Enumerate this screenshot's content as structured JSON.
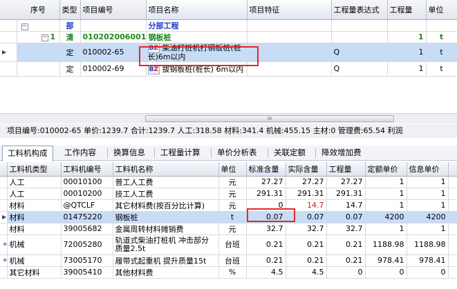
{
  "top_grid": {
    "columns": [
      "序号",
      "类型",
      "项目编号",
      "项目名称",
      "项目特征",
      "工程量表达式",
      "工程量",
      "单位"
    ],
    "rows": {
      "part": {
        "type": "部",
        "name": "分部工程"
      },
      "list": {
        "seq": "1",
        "type": "清",
        "code": "010202006001",
        "name": "钢板桩",
        "qty": "1",
        "unit": "t"
      },
      "item1": {
        "type": "定",
        "code": "010002-65",
        "badge": "BZ",
        "name": "柴油打桩机打钢板桩(桩长)6m以内",
        "expr": "Q",
        "qty": "1",
        "unit": "t"
      },
      "item2": {
        "type": "定",
        "code": "010002-69",
        "badge": "BZ",
        "name": "拔钢板桩(桩长) 6m以内",
        "expr": "Q",
        "qty": "1",
        "unit": "t"
      }
    }
  },
  "scrollbar": {
    "grip": "III"
  },
  "info_bar": "项目编号:010002-65  单价:1239.7  合计:1239.7  人工:318.58  材料:341.4  机械:455.15  主材:0  管理费:65.54  利润",
  "tabs": [
    "工料机构成",
    "工作内容",
    "换算信息",
    "工程量计算",
    "单价分析表",
    "关联定额",
    "降效增加费"
  ],
  "bottom_grid": {
    "columns": [
      "工料机类型",
      "工料机编号",
      "工料机名称",
      "单位",
      "标准含量",
      "实际含量",
      "工程量",
      "定额单价",
      "信息单价"
    ],
    "rows": [
      {
        "type": "人工",
        "code": "00010100",
        "name": "普工人工费",
        "unit": "元",
        "std": "27.27",
        "actual": "27.27",
        "qty": "27.27",
        "price": "1",
        "info": "1"
      },
      {
        "type": "人工",
        "code": "00010200",
        "name": "技工人工费",
        "unit": "元",
        "std": "291.31",
        "actual": "291.31",
        "qty": "291.31",
        "price": "1",
        "info": "1"
      },
      {
        "type": "材料",
        "code": "@QTCLF",
        "name": "其它材料费(按百分比计算)",
        "unit": "元",
        "std": "0",
        "actual": "14.7",
        "qty": "14.7",
        "price": "1",
        "info": "1"
      },
      {
        "type": "材料",
        "code": "01475220",
        "name": "钢板桩",
        "unit": "t",
        "std": "0.07",
        "actual": "0.07",
        "qty": "0.07",
        "price": "4200",
        "info": "4200"
      },
      {
        "type": "材料",
        "code": "39005682",
        "name": "金属周转材料摊销费",
        "unit": "元",
        "std": "32.7",
        "actual": "32.7",
        "qty": "32.7",
        "price": "1",
        "info": "1"
      },
      {
        "type": "机械",
        "code": "72005280",
        "name": "轨道式柴油打桩机 冲击部分质量2.5t",
        "unit": "台班",
        "std": "0.21",
        "actual": "0.21",
        "qty": "0.21",
        "price": "1188.98",
        "info": "1188.98"
      },
      {
        "type": "机械",
        "code": "73005170",
        "name": "履带式起重机 提升质量15t",
        "unit": "台班",
        "std": "0.21",
        "actual": "0.21",
        "qty": "0.21",
        "price": "978.41",
        "info": "978.41"
      },
      {
        "type": "其它材料",
        "code": "39005410",
        "name": "其他材料费",
        "unit": "%",
        "std": "4.5",
        "actual": "4.5",
        "qty": "0",
        "price": "0",
        "info": "0"
      }
    ]
  },
  "colors": {
    "selected_row": "#c8dcf6",
    "highlight_box": "#e22828",
    "list_code": "#1c8a1c",
    "part_text": "#1d3cc8"
  }
}
